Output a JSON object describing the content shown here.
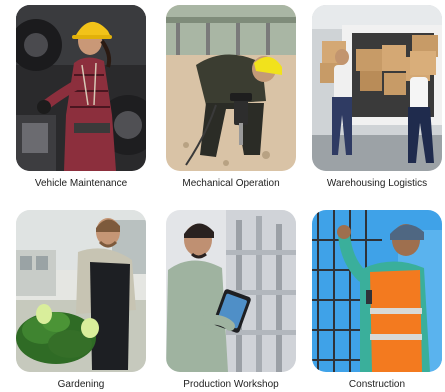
{
  "cards": [
    {
      "caption": "Vehicle Maintenance"
    },
    {
      "caption": "Mechanical Operation"
    },
    {
      "caption": "Warehousing Logistics"
    },
    {
      "caption": "Gardening"
    },
    {
      "caption": "Production Workshop"
    },
    {
      "caption": "Construction"
    }
  ]
}
